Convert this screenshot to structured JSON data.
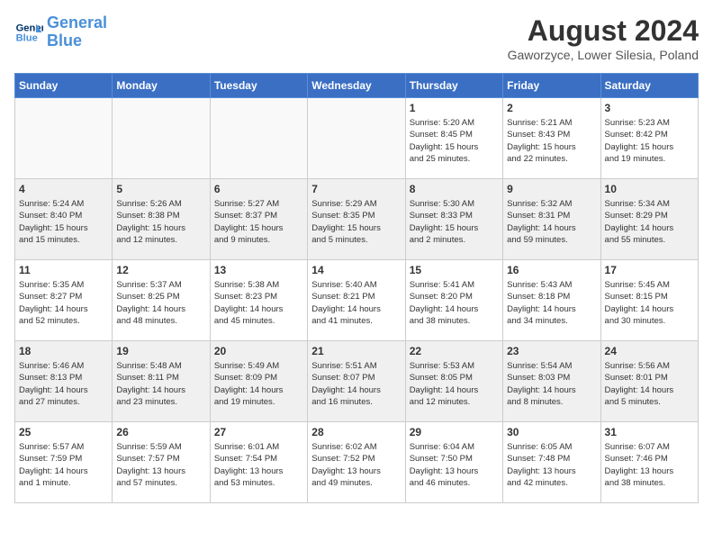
{
  "header": {
    "logo_line1": "General",
    "logo_line2": "Blue",
    "month_year": "August 2024",
    "location": "Gaworzyce, Lower Silesia, Poland"
  },
  "weekdays": [
    "Sunday",
    "Monday",
    "Tuesday",
    "Wednesday",
    "Thursday",
    "Friday",
    "Saturday"
  ],
  "weeks": [
    [
      {
        "day": "",
        "info": ""
      },
      {
        "day": "",
        "info": ""
      },
      {
        "day": "",
        "info": ""
      },
      {
        "day": "",
        "info": ""
      },
      {
        "day": "1",
        "info": "Sunrise: 5:20 AM\nSunset: 8:45 PM\nDaylight: 15 hours\nand 25 minutes."
      },
      {
        "day": "2",
        "info": "Sunrise: 5:21 AM\nSunset: 8:43 PM\nDaylight: 15 hours\nand 22 minutes."
      },
      {
        "day": "3",
        "info": "Sunrise: 5:23 AM\nSunset: 8:42 PM\nDaylight: 15 hours\nand 19 minutes."
      }
    ],
    [
      {
        "day": "4",
        "info": "Sunrise: 5:24 AM\nSunset: 8:40 PM\nDaylight: 15 hours\nand 15 minutes."
      },
      {
        "day": "5",
        "info": "Sunrise: 5:26 AM\nSunset: 8:38 PM\nDaylight: 15 hours\nand 12 minutes."
      },
      {
        "day": "6",
        "info": "Sunrise: 5:27 AM\nSunset: 8:37 PM\nDaylight: 15 hours\nand 9 minutes."
      },
      {
        "day": "7",
        "info": "Sunrise: 5:29 AM\nSunset: 8:35 PM\nDaylight: 15 hours\nand 5 minutes."
      },
      {
        "day": "8",
        "info": "Sunrise: 5:30 AM\nSunset: 8:33 PM\nDaylight: 15 hours\nand 2 minutes."
      },
      {
        "day": "9",
        "info": "Sunrise: 5:32 AM\nSunset: 8:31 PM\nDaylight: 14 hours\nand 59 minutes."
      },
      {
        "day": "10",
        "info": "Sunrise: 5:34 AM\nSunset: 8:29 PM\nDaylight: 14 hours\nand 55 minutes."
      }
    ],
    [
      {
        "day": "11",
        "info": "Sunrise: 5:35 AM\nSunset: 8:27 PM\nDaylight: 14 hours\nand 52 minutes."
      },
      {
        "day": "12",
        "info": "Sunrise: 5:37 AM\nSunset: 8:25 PM\nDaylight: 14 hours\nand 48 minutes."
      },
      {
        "day": "13",
        "info": "Sunrise: 5:38 AM\nSunset: 8:23 PM\nDaylight: 14 hours\nand 45 minutes."
      },
      {
        "day": "14",
        "info": "Sunrise: 5:40 AM\nSunset: 8:21 PM\nDaylight: 14 hours\nand 41 minutes."
      },
      {
        "day": "15",
        "info": "Sunrise: 5:41 AM\nSunset: 8:20 PM\nDaylight: 14 hours\nand 38 minutes."
      },
      {
        "day": "16",
        "info": "Sunrise: 5:43 AM\nSunset: 8:18 PM\nDaylight: 14 hours\nand 34 minutes."
      },
      {
        "day": "17",
        "info": "Sunrise: 5:45 AM\nSunset: 8:15 PM\nDaylight: 14 hours\nand 30 minutes."
      }
    ],
    [
      {
        "day": "18",
        "info": "Sunrise: 5:46 AM\nSunset: 8:13 PM\nDaylight: 14 hours\nand 27 minutes."
      },
      {
        "day": "19",
        "info": "Sunrise: 5:48 AM\nSunset: 8:11 PM\nDaylight: 14 hours\nand 23 minutes."
      },
      {
        "day": "20",
        "info": "Sunrise: 5:49 AM\nSunset: 8:09 PM\nDaylight: 14 hours\nand 19 minutes."
      },
      {
        "day": "21",
        "info": "Sunrise: 5:51 AM\nSunset: 8:07 PM\nDaylight: 14 hours\nand 16 minutes."
      },
      {
        "day": "22",
        "info": "Sunrise: 5:53 AM\nSunset: 8:05 PM\nDaylight: 14 hours\nand 12 minutes."
      },
      {
        "day": "23",
        "info": "Sunrise: 5:54 AM\nSunset: 8:03 PM\nDaylight: 14 hours\nand 8 minutes."
      },
      {
        "day": "24",
        "info": "Sunrise: 5:56 AM\nSunset: 8:01 PM\nDaylight: 14 hours\nand 5 minutes."
      }
    ],
    [
      {
        "day": "25",
        "info": "Sunrise: 5:57 AM\nSunset: 7:59 PM\nDaylight: 14 hours\nand 1 minute."
      },
      {
        "day": "26",
        "info": "Sunrise: 5:59 AM\nSunset: 7:57 PM\nDaylight: 13 hours\nand 57 minutes."
      },
      {
        "day": "27",
        "info": "Sunrise: 6:01 AM\nSunset: 7:54 PM\nDaylight: 13 hours\nand 53 minutes."
      },
      {
        "day": "28",
        "info": "Sunrise: 6:02 AM\nSunset: 7:52 PM\nDaylight: 13 hours\nand 49 minutes."
      },
      {
        "day": "29",
        "info": "Sunrise: 6:04 AM\nSunset: 7:50 PM\nDaylight: 13 hours\nand 46 minutes."
      },
      {
        "day": "30",
        "info": "Sunrise: 6:05 AM\nSunset: 7:48 PM\nDaylight: 13 hours\nand 42 minutes."
      },
      {
        "day": "31",
        "info": "Sunrise: 6:07 AM\nSunset: 7:46 PM\nDaylight: 13 hours\nand 38 minutes."
      }
    ]
  ]
}
